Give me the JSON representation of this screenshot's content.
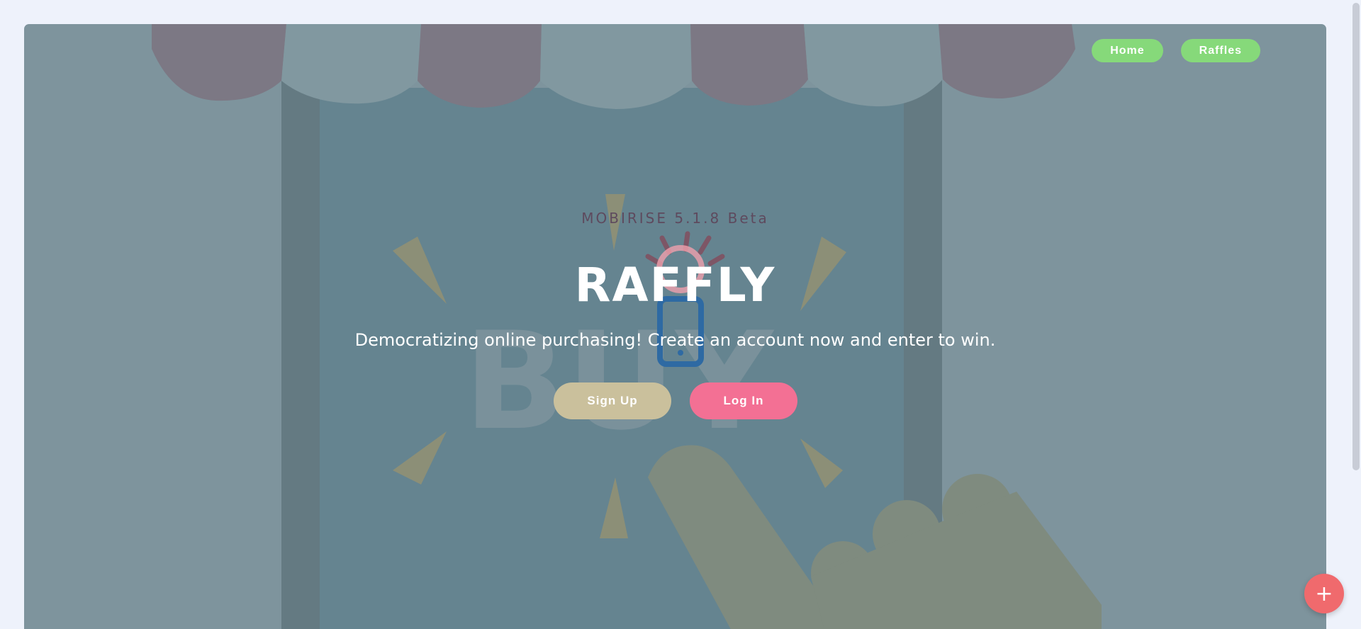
{
  "nav": {
    "home_label": "Home",
    "raffles_label": "Raffles"
  },
  "hero": {
    "badge": "MOBIRISE  5.1.8 Beta",
    "title": "RAFFLY",
    "subtitle": "Democratizing online purchasing! Create an account now and enter to win.",
    "signup_label": "Sign Up",
    "login_label": "Log In",
    "background_word": "BUY"
  },
  "fab": {
    "icon": "plus-icon",
    "symbol": "+"
  },
  "colors": {
    "nav_button": "#86d97a",
    "signup_button": "#cac09c",
    "login_button": "#f37094",
    "fab": "#f06a6d",
    "overlay": "#7e949d"
  }
}
